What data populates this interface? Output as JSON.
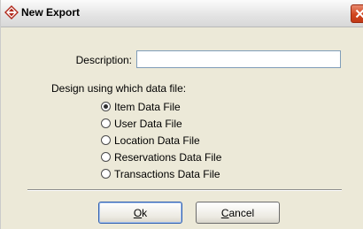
{
  "window": {
    "title": "New Export",
    "app_icon": "diamond-arrows-icon",
    "close_icon": "close-icon",
    "close_color": "#d1451f"
  },
  "form": {
    "description_label": "Description:",
    "description_value": "",
    "description_placeholder": "",
    "design_label": "Design using which data file:",
    "options": [
      {
        "label": "Item Data File",
        "checked": true
      },
      {
        "label": "User Data File",
        "checked": false
      },
      {
        "label": "Location Data File",
        "checked": false
      },
      {
        "label": "Reservations Data File",
        "checked": false
      },
      {
        "label": "Transactions Data File",
        "checked": false
      }
    ]
  },
  "buttons": {
    "ok_mnemonic": "O",
    "ok_rest": "k",
    "cancel_mnemonic": "C",
    "cancel_rest": "ancel"
  }
}
